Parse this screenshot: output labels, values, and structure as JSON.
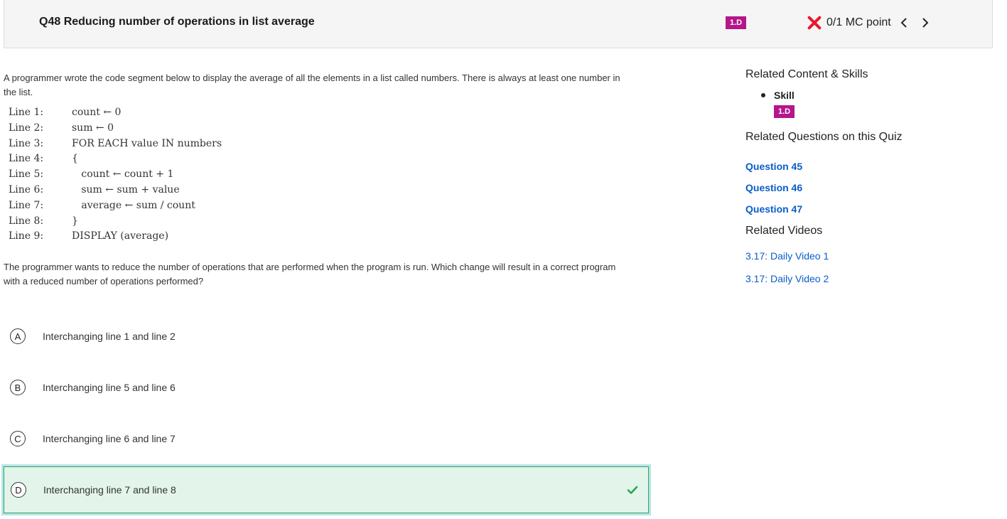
{
  "header": {
    "title": "Q48 Reducing number of operations in list average",
    "skill_badge": "1.D",
    "score": "0/1 MC point",
    "prev_icon": "chevron-left-icon",
    "next_icon": "chevron-right-icon",
    "status_icon": "x-icon",
    "status_color": "#e8192c"
  },
  "question": {
    "prompt": "A programmer wrote the code segment below to display the average of all the elements in a list called numbers. There is always at least one number in the list.",
    "code": [
      {
        "line": "Line 1:",
        "text": "count ← 0"
      },
      {
        "line": "Line 2:",
        "text": "sum ← 0"
      },
      {
        "line": "Line 3:",
        "text": "FOR EACH value IN numbers"
      },
      {
        "line": "Line 4:",
        "text": "{"
      },
      {
        "line": "Line 5:",
        "text": "   count ← count + 1"
      },
      {
        "line": "Line 6:",
        "text": "   sum ← sum + value"
      },
      {
        "line": "Line 7:",
        "text": "   average ← sum / count"
      },
      {
        "line": "Line 8:",
        "text": "}"
      },
      {
        "line": "Line 9:",
        "text": "DISPLAY (average)"
      }
    ],
    "prompt2": "The programmer wants to reduce the number of operations that are performed when the program is run. Which change will result in a correct program with a reduced number of operations performed?"
  },
  "choices": [
    {
      "letter": "A",
      "text": "Interchanging line 1 and line 2"
    },
    {
      "letter": "B",
      "text": "Interchanging line 5 and line 6"
    },
    {
      "letter": "C",
      "text": "Interchanging line 6 and line 7"
    },
    {
      "letter": "D",
      "text": "Interchanging line 7 and line 8",
      "correct": true
    }
  ],
  "colors": {
    "accent_badge": "#b5168a",
    "correct_bg": "#e3f4ea",
    "correct_border": "#2aa65a",
    "link": "#0a5ec8"
  },
  "sidebar": {
    "related_heading": "Related Content & Skills",
    "skill_label": "Skill",
    "skill_badge": "1.D",
    "questions_heading": "Related Questions on this Quiz",
    "questions": [
      "Question 45",
      "Question 46",
      "Question 47"
    ],
    "videos_heading": "Related Videos",
    "videos": [
      "3.17: Daily Video 1",
      "3.17: Daily Video 2"
    ]
  }
}
